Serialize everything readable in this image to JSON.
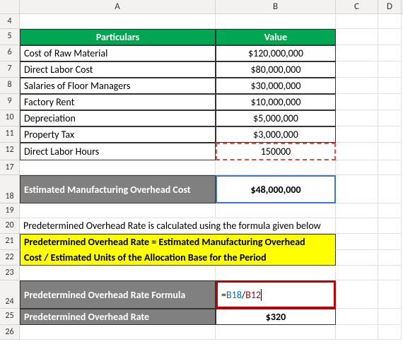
{
  "columns": [
    "A",
    "B",
    "C",
    "D"
  ],
  "rows": [
    "4",
    "5",
    "6",
    "7",
    "8",
    "9",
    "10",
    "11",
    "12",
    "17",
    "18",
    "19",
    "20",
    "21",
    "22",
    "23",
    "24",
    "25",
    "26"
  ],
  "header": {
    "particulars": "Particulars",
    "value": "Value"
  },
  "data": {
    "r6": {
      "label": "Cost of Raw Material",
      "value": "$120,000,000"
    },
    "r7": {
      "label": "Direct Labor Cost",
      "value": "$80,000,000"
    },
    "r8": {
      "label": "Salaries of Floor Managers",
      "value": "$30,000,000"
    },
    "r9": {
      "label": "Factory Rent",
      "value": "$10,000,000"
    },
    "r10": {
      "label": "Depreciation",
      "value": "$5,000,000"
    },
    "r11": {
      "label": "Property Tax",
      "value": "$3,000,000"
    },
    "r12": {
      "label": "Direct Labor Hours",
      "value": "150000"
    }
  },
  "overhead": {
    "label": "Estimated Manufacturing Overhead Cost",
    "value": "$48,000,000"
  },
  "note": "Predetermined Overhead Rate is calculated using the formula given below",
  "formula_banner": {
    "line1": "Predetermined Overhead Rate = Estimated Manufacturing Overhead",
    "line2": "Cost / Estimated Units of the Allocation Base for the Period"
  },
  "formula_row": {
    "label": "Predetermined Overhead Rate Formula",
    "eq": "=",
    "ref1": "B18",
    "slash": "/",
    "ref2": "B12"
  },
  "result": {
    "label": "Predetermined Overhead Rate",
    "value": "$320"
  },
  "chart_data": {
    "type": "table",
    "title": "Predetermined Overhead Rate Calculation",
    "rows": [
      {
        "Particulars": "Cost of Raw Material",
        "Value": 120000000
      },
      {
        "Particulars": "Direct Labor Cost",
        "Value": 80000000
      },
      {
        "Particulars": "Salaries of Floor Managers",
        "Value": 30000000
      },
      {
        "Particulars": "Factory Rent",
        "Value": 10000000
      },
      {
        "Particulars": "Depreciation",
        "Value": 5000000
      },
      {
        "Particulars": "Property Tax",
        "Value": 3000000
      },
      {
        "Particulars": "Direct Labor Hours",
        "Value": 150000
      }
    ],
    "derived": {
      "Estimated Manufacturing Overhead Cost": 48000000,
      "Predetermined Overhead Rate": 320,
      "formula": "Predetermined Overhead Rate = Estimated Manufacturing Overhead Cost / Estimated Units of the Allocation Base for the Period",
      "cell_formula": "=B18/B12"
    }
  }
}
